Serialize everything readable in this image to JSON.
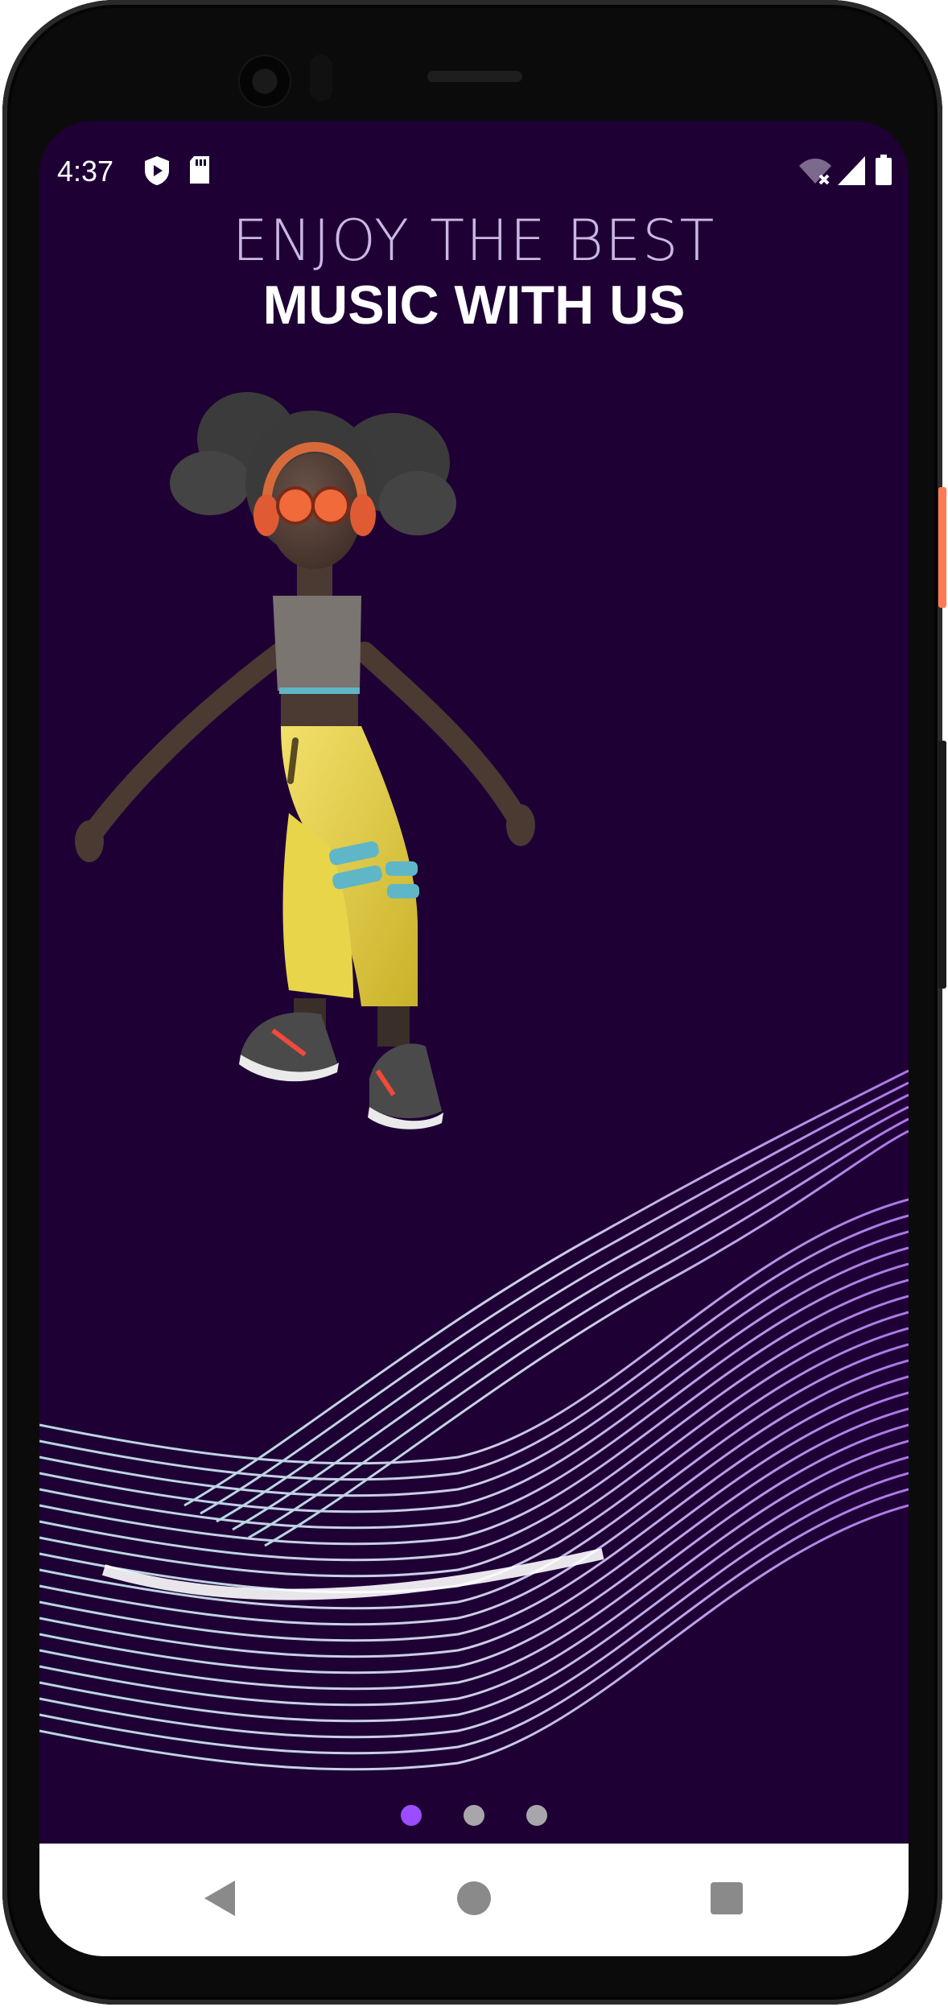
{
  "status_bar": {
    "time": "4:37",
    "left_icons": [
      "shield-play-icon",
      "sd-card-icon"
    ],
    "right_icons": [
      "wifi-off-icon",
      "cell-signal-icon",
      "battery-icon"
    ]
  },
  "onboarding": {
    "headline_light": "ENJOY THE BEST",
    "headline_bold": "MUSIC WITH US",
    "illustration": "dancing-girl-with-headphones-on-sound-wave",
    "pages": 3,
    "active_page": 1
  },
  "colors": {
    "background": "#1e0035",
    "dot_active": "#9b4dff",
    "dot_inactive": "#a9a6ab",
    "pants": "#e6d040",
    "wave": "#c9b3f0"
  },
  "navigation_bar": {
    "buttons": [
      "back-icon",
      "home-icon",
      "recents-icon"
    ]
  }
}
